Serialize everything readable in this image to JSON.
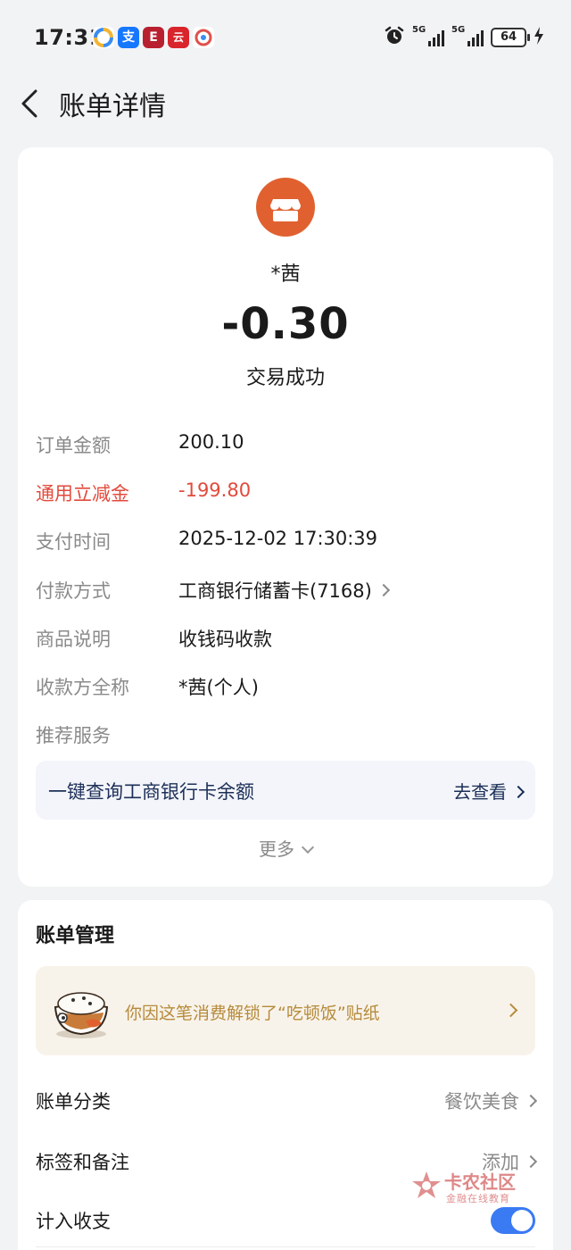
{
  "status_bar": {
    "time": "17:31",
    "apps": [
      {
        "icon": "color-wheel-app-icon",
        "color": "#3a8df0"
      },
      {
        "icon": "alipay-icon",
        "label": "支",
        "color": "#1677ff"
      },
      {
        "icon": "unionpay-icon",
        "label": "E",
        "color": "#b8202f"
      },
      {
        "icon": "yunshanfu-icon",
        "label": "云",
        "color": "#d9242b"
      },
      {
        "icon": "camera-app-icon",
        "color": "#e0504b"
      }
    ],
    "network": [
      "5G",
      "5G"
    ],
    "battery": "64"
  },
  "header": {
    "title": "账单详情"
  },
  "transaction": {
    "merchant_name": "*茜",
    "amount": "-0.30",
    "status": "交易成功",
    "merchant_icon_color": "#e0612f"
  },
  "details": [
    {
      "label": "订单金额",
      "value": "200.10"
    },
    {
      "label": "通用立减金",
      "value": "-199.80"
    },
    {
      "label": "支付时间",
      "value": "2025-12-02 17:30:39"
    },
    {
      "label": "付款方式",
      "value": "工商银行储蓄卡(7168)"
    },
    {
      "label": "商品说明",
      "value": "收钱码收款"
    },
    {
      "label": "收款方全称",
      "value": "*茜(个人)"
    },
    {
      "label": "推荐服务",
      "value": ""
    }
  ],
  "recommend": {
    "text": "一键查询工商银行卡余额",
    "link": "去查看"
  },
  "more": "更多",
  "bill_management": {
    "title": "账单管理",
    "sticker_text": "你因这笔消费解锁了“吃顿饭”贴纸",
    "rows": [
      {
        "label": "账单分类",
        "value": "餐饮美食"
      },
      {
        "label": "标签和备注",
        "value": "添加"
      },
      {
        "label": "计入收支",
        "toggle": true
      }
    ]
  },
  "watermark": {
    "title": "卡农社区",
    "subtitle": "金融在线教育"
  },
  "colors": {
    "accent": "#3a7af3",
    "negative": "#e24a3c",
    "merchant": "#e0612f",
    "sticker_text": "#b68b3c"
  }
}
